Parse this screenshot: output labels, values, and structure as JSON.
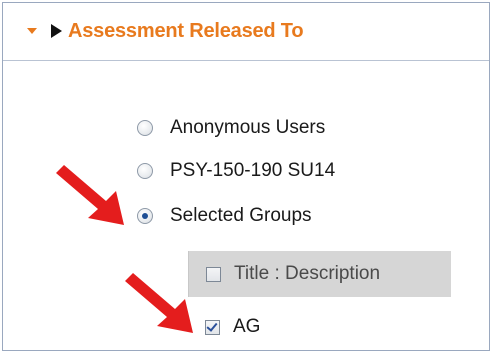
{
  "section": {
    "title": "Assessment Released To"
  },
  "options": [
    {
      "label": "Anonymous Users",
      "checked": false
    },
    {
      "label": "PSY-150-190 SU14",
      "checked": false
    },
    {
      "label": "Selected Groups",
      "checked": true
    }
  ],
  "groups_table": {
    "header_label": "Title : Description",
    "header_checked": false,
    "rows": [
      {
        "label": "AG",
        "checked": true
      }
    ]
  },
  "annotations": {
    "arrow_color": "#e41d1d"
  },
  "colors": {
    "title_accent": "#e87a1e",
    "panel_border": "#9aa8bf",
    "group_header_bg": "#d6d6d6"
  },
  "icons": {
    "collapse": "caret-down-icon",
    "expand": "triangle-right-icon"
  }
}
